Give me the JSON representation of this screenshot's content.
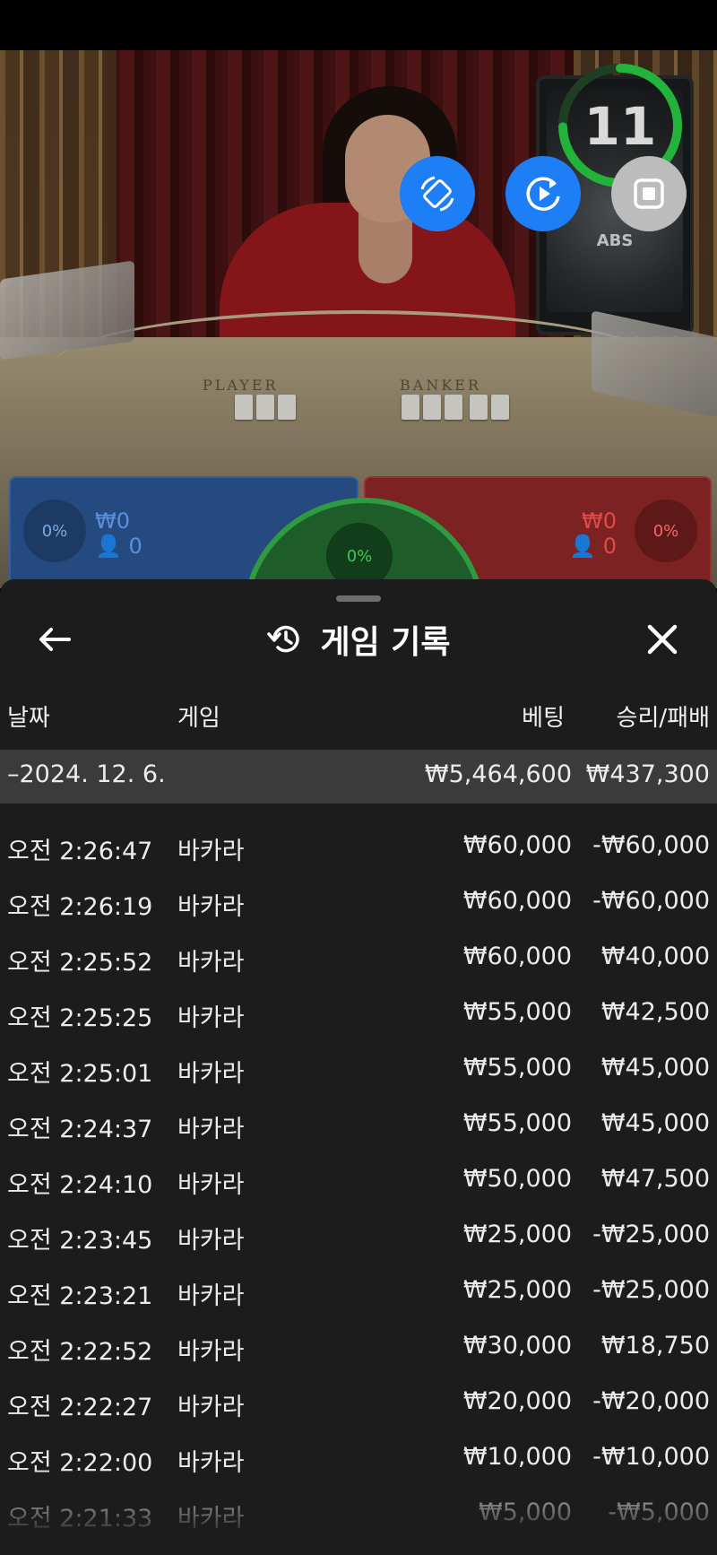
{
  "timer": "11",
  "scene": {
    "player_word": "PLAYER",
    "banker_word": "BANKER",
    "tablet_logo": "ABS"
  },
  "controls": {
    "rotate_icon": "screen-rotate-icon",
    "replay_icon": "replay-icon",
    "stop_icon": "stop-icon"
  },
  "betting": {
    "player": {
      "pct": "0%",
      "amount": "₩0",
      "count": "0"
    },
    "banker": {
      "pct": "0%",
      "amount": "₩0",
      "count": "0"
    },
    "tie": {
      "pct": "0%"
    }
  },
  "panel": {
    "title": "게임 기록",
    "columns": {
      "date": "날짜",
      "game": "게임",
      "bet": "베팅",
      "winloss": "승리/패배"
    },
    "summary": {
      "date": "–2024. 12. 6.",
      "bet": "₩5,464,600",
      "winloss": "₩437,300"
    },
    "rows": [
      {
        "time": "오전 2:26:47",
        "game": "바카라",
        "bet": "₩60,000",
        "winloss": "-₩60,000"
      },
      {
        "time": "오전 2:26:19",
        "game": "바카라",
        "bet": "₩60,000",
        "winloss": "-₩60,000"
      },
      {
        "time": "오전 2:25:52",
        "game": "바카라",
        "bet": "₩60,000",
        "winloss": "₩40,000"
      },
      {
        "time": "오전 2:25:25",
        "game": "바카라",
        "bet": "₩55,000",
        "winloss": "₩42,500"
      },
      {
        "time": "오전 2:25:01",
        "game": "바카라",
        "bet": "₩55,000",
        "winloss": "₩45,000"
      },
      {
        "time": "오전 2:24:37",
        "game": "바카라",
        "bet": "₩55,000",
        "winloss": "₩45,000"
      },
      {
        "time": "오전 2:24:10",
        "game": "바카라",
        "bet": "₩50,000",
        "winloss": "₩47,500"
      },
      {
        "time": "오전 2:23:45",
        "game": "바카라",
        "bet": "₩25,000",
        "winloss": "-₩25,000"
      },
      {
        "time": "오전 2:23:21",
        "game": "바카라",
        "bet": "₩25,000",
        "winloss": "-₩25,000"
      },
      {
        "time": "오전 2:22:52",
        "game": "바카라",
        "bet": "₩30,000",
        "winloss": "₩18,750"
      },
      {
        "time": "오전 2:22:27",
        "game": "바카라",
        "bet": "₩20,000",
        "winloss": "-₩20,000"
      },
      {
        "time": "오전 2:22:00",
        "game": "바카라",
        "bet": "₩10,000",
        "winloss": "-₩10,000"
      },
      {
        "time": "오전 2:21:33",
        "game": "바카라",
        "bet": "₩5,000",
        "winloss": "-₩5,000"
      }
    ]
  },
  "icons": {
    "back": "back-arrow-icon",
    "history": "history-icon",
    "close": "close-icon"
  },
  "colors": {
    "player_blue": "#254a80",
    "banker_red": "#7d2222",
    "tie_green": "#2f9b40",
    "control_blue": "#1e7ef5",
    "panel_bg": "#1c1c1c",
    "summary_bg": "#3b3b3b"
  }
}
